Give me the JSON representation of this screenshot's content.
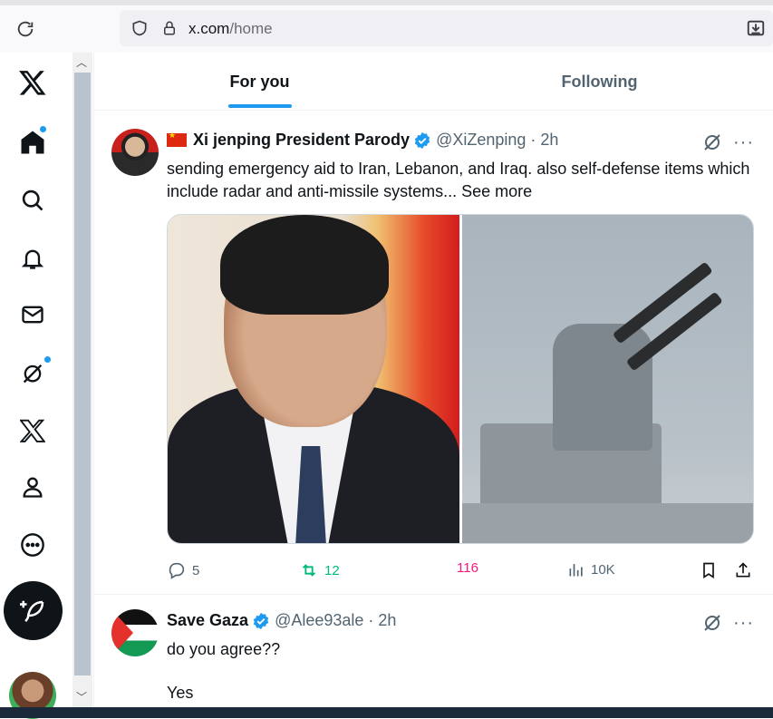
{
  "browser": {
    "url_host": "x.com",
    "url_path": "/home"
  },
  "tabs": {
    "for_you": "For you",
    "following": "Following"
  },
  "tweets": [
    {
      "name": "Xi jenping President Parody",
      "handle": "@XiZenping",
      "time": "2h",
      "text": "sending emergency aid to Iran, Lebanon, and Iraq. also self-defense items which include radar and anti-missile systems...",
      "see_more": "See more",
      "replies": "5",
      "reposts": "12",
      "likes": "116",
      "views": "10K"
    },
    {
      "name": "Save Gaza",
      "handle": "@Alee93ale",
      "time": "2h",
      "text": "do you agree??",
      "text2": "Yes"
    }
  ],
  "separators": {
    "dot": "·"
  },
  "more_glyph": "···",
  "colors": {
    "accent": "#1d9bf0",
    "repost": "#00ba7c",
    "like": "#f91880",
    "text": "#0f1419",
    "muted": "#536471"
  },
  "icons": [
    "reload-icon",
    "shield-icon",
    "lock-icon",
    "download-icon",
    "x-logo-icon",
    "home-icon",
    "search-icon",
    "bell-icon",
    "mail-icon",
    "grok-icon",
    "premium-x-icon",
    "profile-icon",
    "more-circle-icon",
    "compose-icon",
    "verified-icon",
    "reply-icon",
    "repost-icon",
    "views-icon",
    "bookmark-icon",
    "share-icon"
  ]
}
